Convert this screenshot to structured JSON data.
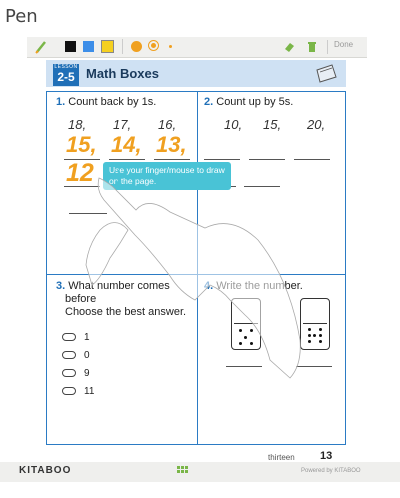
{
  "window": {
    "title": "Pen"
  },
  "toolbar": {
    "done_label": "Done",
    "colors": [
      "#111111",
      "#3d8ee8",
      "#f5d020"
    ],
    "dot_color": "#f0a020"
  },
  "page": {
    "lesson_small": "LESSON",
    "lesson_number": "2-5",
    "heading": "Math Boxes",
    "q1": {
      "number": "1.",
      "text": "Count back by 1s.",
      "given": [
        "18,",
        "17,",
        "16,"
      ],
      "written": [
        "15,",
        "14,",
        "13,",
        "12"
      ]
    },
    "q2": {
      "number": "2.",
      "text": "Count up by 5s.",
      "given": [
        "10,",
        "15,",
        "20,"
      ]
    },
    "q3": {
      "number": "3.",
      "line1": "What number comes",
      "line2": "before",
      "line3": "Choose the best answer.",
      "choices": [
        "1",
        "0",
        "9",
        "11"
      ]
    },
    "q4": {
      "number": "4.",
      "text": "Write the number."
    },
    "tooltip": "Use your finger/mouse to draw on the page.",
    "footer_word": "thirteen",
    "footer_number": "13"
  },
  "bottom": {
    "logo": "KITABOO",
    "powered": "Powered by KITABOO"
  }
}
